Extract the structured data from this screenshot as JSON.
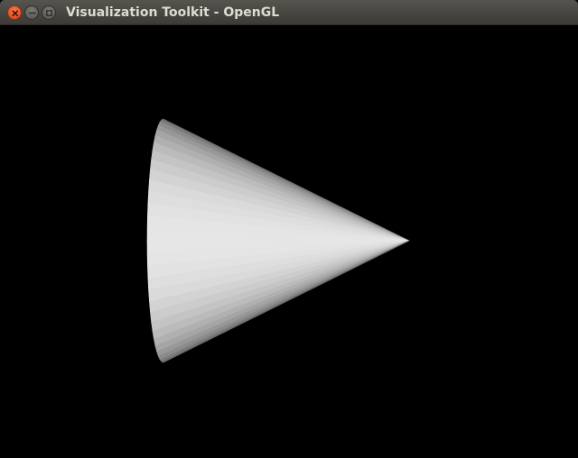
{
  "window": {
    "title": "Visualization Toolkit - OpenGL"
  },
  "controls": {
    "close_icon": "close-icon",
    "minimize_icon": "minimize-icon",
    "maximize_icon": "maximize-icon"
  },
  "scene": {
    "background_color": "#000000",
    "object": "cone",
    "object_color": "#e6e6e6",
    "facet_count": 30
  }
}
